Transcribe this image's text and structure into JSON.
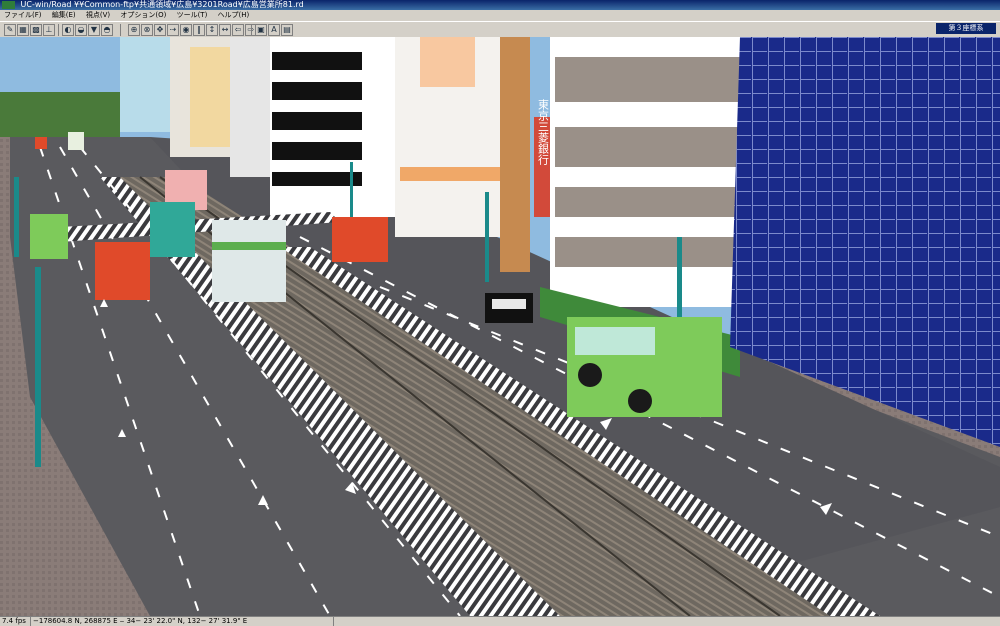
{
  "window": {
    "title": "UC-win/Road  ¥¥Common-ftp¥共通領域¥広島¥3201Road¥広島営業所81.rd"
  },
  "menu": [
    "ファイル(F)",
    "編集(E)",
    "視点(V)",
    "オプション(O)",
    "ツール(T)",
    "ヘルプ(H)"
  ],
  "toolbar": {
    "buttons": [
      {
        "name": "edit-tool",
        "glyph": "✎"
      },
      {
        "name": "grid-tool",
        "glyph": "▦"
      },
      {
        "name": "terrain-tool",
        "glyph": "▩"
      },
      {
        "name": "road-tool",
        "glyph": "⊥"
      },
      {
        "name": "view-a",
        "glyph": "◐"
      },
      {
        "name": "view-b",
        "glyph": "◒"
      },
      {
        "name": "view-c",
        "glyph": "▼"
      },
      {
        "name": "view-d",
        "glyph": "◓"
      },
      {
        "name": "nav-1",
        "glyph": "⊕"
      },
      {
        "name": "nav-2",
        "glyph": "⊗"
      },
      {
        "name": "nav-3",
        "glyph": "✥"
      },
      {
        "name": "nav-4",
        "glyph": "⇢"
      },
      {
        "name": "nav-5",
        "glyph": "◉"
      },
      {
        "name": "nav-6",
        "glyph": "‖"
      },
      {
        "name": "nav-7",
        "glyph": "↕"
      },
      {
        "name": "nav-8",
        "glyph": "↔"
      },
      {
        "name": "nav-9",
        "glyph": "⇦"
      },
      {
        "name": "nav-10",
        "glyph": "⇨"
      },
      {
        "name": "cam-1",
        "glyph": "▣"
      },
      {
        "name": "cam-2",
        "glyph": "A"
      },
      {
        "name": "cam-3",
        "glyph": "▤"
      }
    ],
    "coord_label": "第３座標系"
  },
  "scene": {
    "colors": {
      "sky": "#8fbbe0",
      "road": "#5a5a5e",
      "sidewalk": "#8a7c78",
      "grass": "#4a7a3a",
      "tram_rail": "#6e6860",
      "bus_green": "#7ecb5a",
      "bus_red": "#e04a2a",
      "glass_building": "#1a2a8a"
    },
    "bank_sign": "東京三菱銀行"
  },
  "status": {
    "fps": "7.4 fps",
    "coords": "−178604.8 N, 268875 E  ‒ 34− 23' 22.0\" N, 132− 27' 31.9\" E"
  }
}
